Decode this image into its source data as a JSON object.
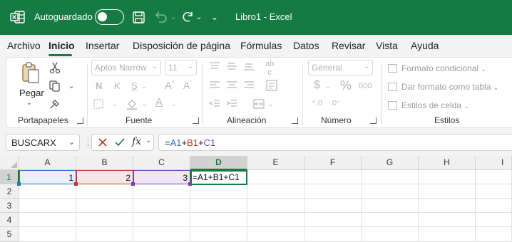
{
  "titlebar": {
    "autosave_label": "Autoguardado",
    "autosave_on": false,
    "title": "Libro1  -  Excel",
    "more_glyph": "⌄"
  },
  "tabs": [
    {
      "label": "Archivo",
      "active": false
    },
    {
      "label": "Inicio",
      "active": true
    },
    {
      "label": "Insertar",
      "active": false
    },
    {
      "label": "Disposición de página",
      "active": false
    },
    {
      "label": "Fórmulas",
      "active": false
    },
    {
      "label": "Datos",
      "active": false
    },
    {
      "label": "Revisar",
      "active": false
    },
    {
      "label": "Vista",
      "active": false
    },
    {
      "label": "Ayuda",
      "active": false
    }
  ],
  "ribbon": {
    "clipboard": {
      "label": "Portapapeles",
      "paste_label": "Pegar"
    },
    "font": {
      "label": "Fuente",
      "font_name": "Aptos Narrow",
      "font_size": "11",
      "bold": "N",
      "italic": "K",
      "underline": "S"
    },
    "alignment": {
      "label": "Alineación"
    },
    "number": {
      "label": "Número",
      "format": "General",
      "currency": "$",
      "percent": "%",
      "thousands": "000"
    },
    "styles": {
      "label": "Estilos",
      "conditional": "Formato condicional",
      "as_table": "Dar formato como tabla",
      "cell_styles": "Estilos de celda"
    }
  },
  "formula_bar": {
    "name_box": "BUSCARX",
    "parts": [
      {
        "text": "=",
        "color": "#242424"
      },
      {
        "text": "A1",
        "color": "#2f6fc9"
      },
      {
        "text": "+",
        "color": "#242424"
      },
      {
        "text": "B1",
        "color": "#c0392b"
      },
      {
        "text": "+",
        "color": "#242424"
      },
      {
        "text": "C1",
        "color": "#7a3fb2"
      }
    ]
  },
  "grid": {
    "columns": [
      "A",
      "B",
      "C",
      "D",
      "E",
      "F",
      "G",
      "H",
      "I"
    ],
    "rows": [
      "1",
      "2",
      "3",
      "4",
      "5"
    ],
    "active_column": "D",
    "active_row": "1",
    "cells": {
      "A1": "1",
      "B1": "2",
      "C1": "3",
      "D1": "=A1+B1+C1"
    }
  },
  "colors": {
    "accent": "#167a43",
    "ref_a1": "#2f6fc9",
    "ref_b1": "#c0392b",
    "ref_c1": "#7a3fb2"
  }
}
